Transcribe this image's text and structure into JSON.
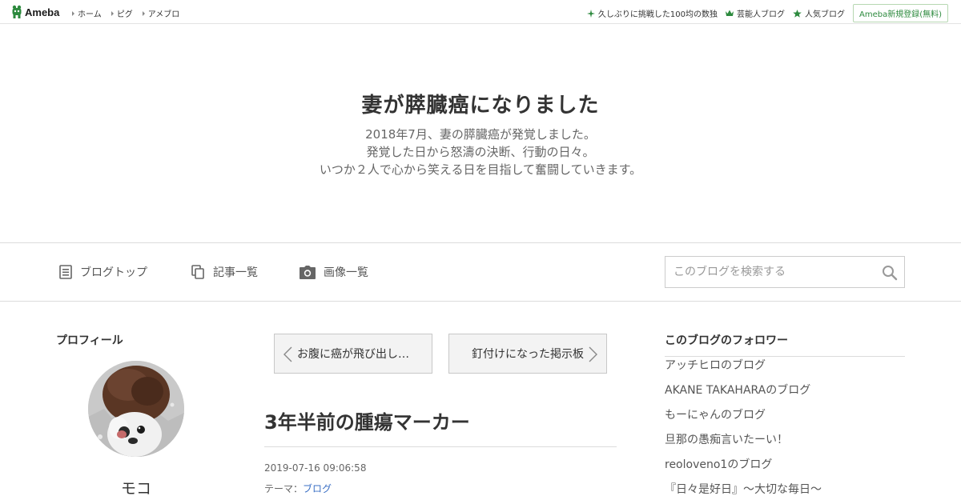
{
  "topbar": {
    "logo_text": "Ameba",
    "nav": [
      "ホーム",
      "ピグ",
      "アメブロ"
    ],
    "right_links": [
      {
        "label": "久しぶりに挑戦した100均の数独",
        "icon": "sparkle-icon"
      },
      {
        "label": "芸能人ブログ",
        "icon": "crown-icon"
      },
      {
        "label": "人気ブログ",
        "icon": "star-icon"
      }
    ],
    "register_label": "Ameba新規登録(無料)"
  },
  "header": {
    "title": "妻が膵臓癌になりました",
    "description": [
      "2018年7月、妻の膵臓癌が発覚しました。",
      "発覚した日から怒濤の決断、行動の日々。",
      "いつか２人で心から笑える日を目指して奮闘していきます。"
    ]
  },
  "nav": {
    "items": [
      {
        "label": "ブログトップ",
        "icon": "document-icon"
      },
      {
        "label": "記事一覧",
        "icon": "copy-icon"
      },
      {
        "label": "画像一覧",
        "icon": "camera-icon"
      }
    ],
    "search_placeholder": "このブログを検索する"
  },
  "profile": {
    "heading": "プロフィール",
    "name": "モコ"
  },
  "pager": {
    "prev_label": "お腹に癌が飛び出し…",
    "next_label": "釘付けになった掲示板"
  },
  "article": {
    "title": "3年半前の腫瘍マーカー",
    "date": "2019-07-16 09:06:58",
    "theme_prefix": "テーマ：",
    "theme_link": "ブログ"
  },
  "followers": {
    "heading": "このブログのフォロワー",
    "items": [
      "アッチヒロのブログ",
      "AKANE TAKAHARAのブログ",
      "もーにゃんのブログ",
      "旦那の愚痴言いたーい！",
      "reoloveno1のブログ",
      "『日々是好日』～大切な毎日～"
    ]
  },
  "colors": {
    "ameba_green": "#2d8a3e",
    "link_blue": "#3a6fc4"
  }
}
